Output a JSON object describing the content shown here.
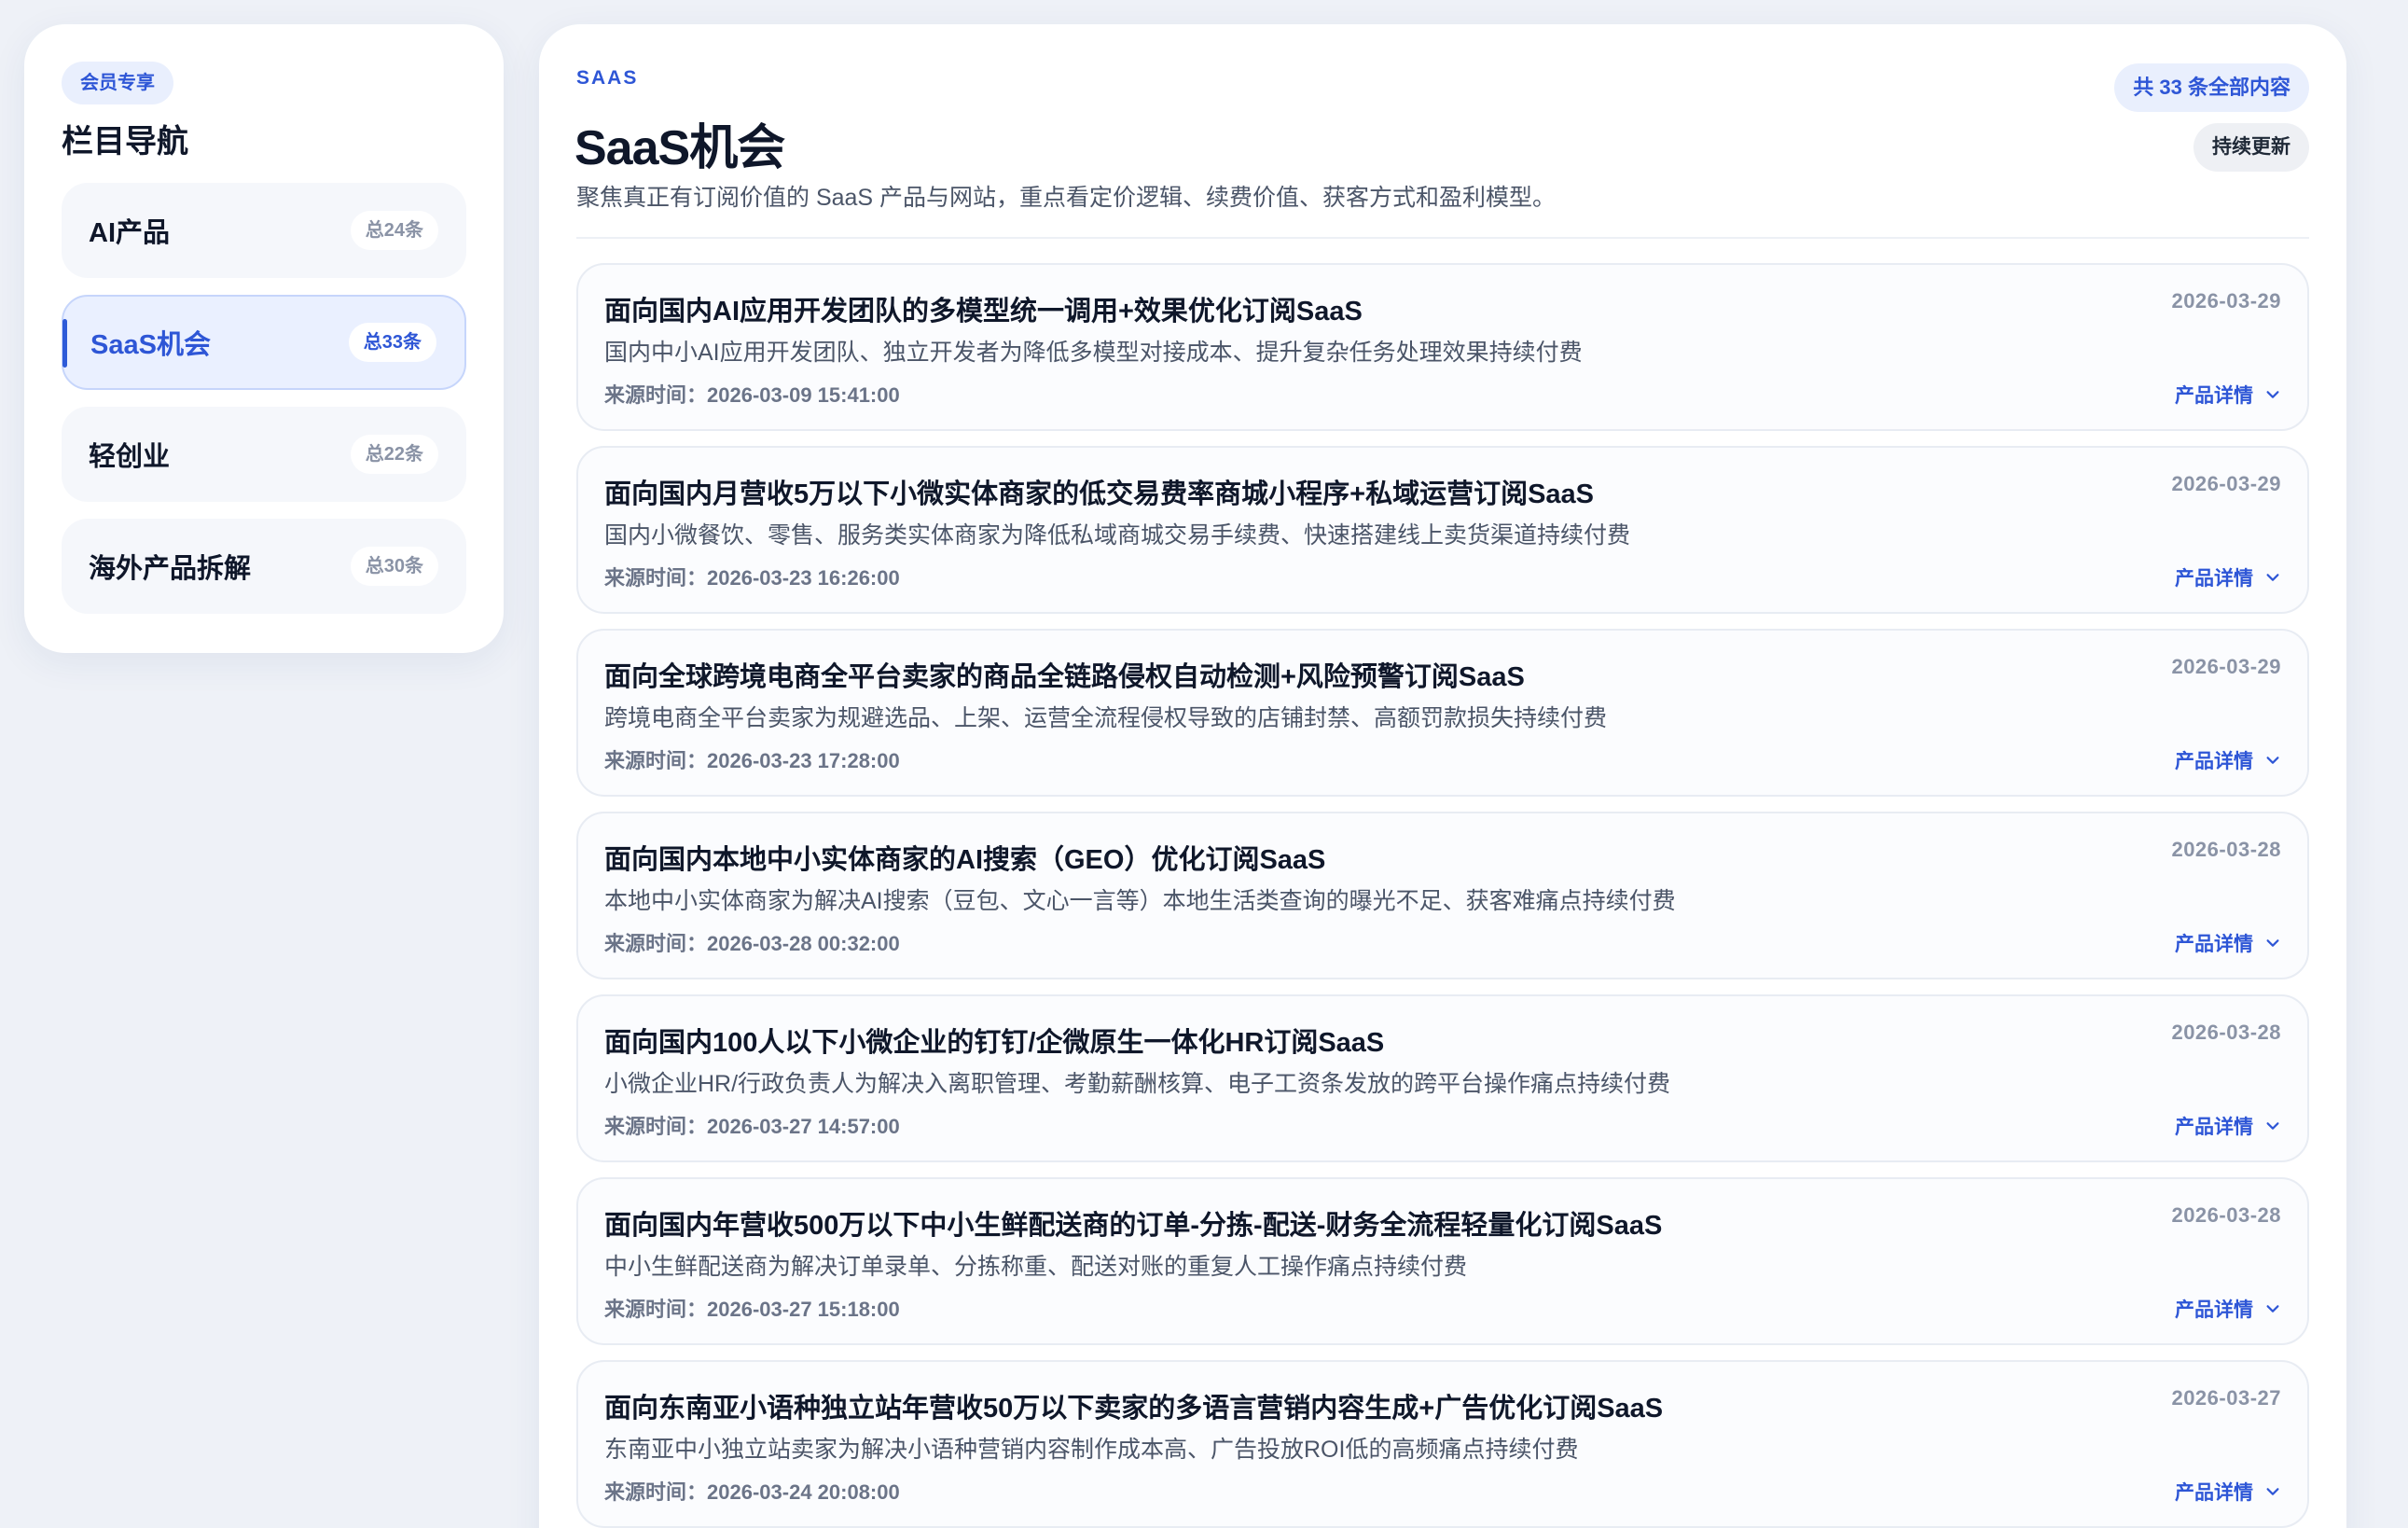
{
  "sidebar": {
    "badge": "会员专享",
    "title": "栏目导航",
    "items": [
      {
        "label": "AI产品",
        "count": "总24条",
        "active": false
      },
      {
        "label": "SaaS机会",
        "count": "总33条",
        "active": true
      },
      {
        "label": "轻创业",
        "count": "总22条",
        "active": false
      },
      {
        "label": "海外产品拆解",
        "count": "总30条",
        "active": false
      }
    ]
  },
  "main": {
    "kicker": "SAAS",
    "title": "SaaS机会",
    "description": "聚焦真正有订阅价值的 SaaS 产品与网站，重点看定价逻辑、续费价值、获客方式和盈利模型。",
    "total_badge": "共 33 条全部内容",
    "update_badge": "持续更新",
    "source_prefix": "来源时间：",
    "detail_label": "产品详情",
    "cards": [
      {
        "title": "面向国内AI应用开发团队的多模型统一调用+效果优化订阅SaaS",
        "date": "2026-03-29",
        "description": "国内中小AI应用开发团队、独立开发者为降低多模型对接成本、提升复杂任务处理效果持续付费",
        "source_time": "2026-03-09 15:41:00"
      },
      {
        "title": "面向国内月营收5万以下小微实体商家的低交易费率商城小程序+私域运营订阅SaaS",
        "date": "2026-03-29",
        "description": "国内小微餐饮、零售、服务类实体商家为降低私域商城交易手续费、快速搭建线上卖货渠道持续付费",
        "source_time": "2026-03-23 16:26:00"
      },
      {
        "title": "面向全球跨境电商全平台卖家的商品全链路侵权自动检测+风险预警订阅SaaS",
        "date": "2026-03-29",
        "description": "跨境电商全平台卖家为规避选品、上架、运营全流程侵权导致的店铺封禁、高额罚款损失持续付费",
        "source_time": "2026-03-23 17:28:00"
      },
      {
        "title": "面向国内本地中小实体商家的AI搜索（GEO）优化订阅SaaS",
        "date": "2026-03-28",
        "description": "本地中小实体商家为解决AI搜索（豆包、文心一言等）本地生活类查询的曝光不足、获客难痛点持续付费",
        "source_time": "2026-03-28 00:32:00"
      },
      {
        "title": "面向国内100人以下小微企业的钉钉/企微原生一体化HR订阅SaaS",
        "date": "2026-03-28",
        "description": "小微企业HR/行政负责人为解决入离职管理、考勤薪酬核算、电子工资条发放的跨平台操作痛点持续付费",
        "source_time": "2026-03-27 14:57:00"
      },
      {
        "title": "面向国内年营收500万以下中小生鲜配送商的订单-分拣-配送-财务全流程轻量化订阅SaaS",
        "date": "2026-03-28",
        "description": "中小生鲜配送商为解决订单录单、分拣称重、配送对账的重复人工操作痛点持续付费",
        "source_time": "2026-03-27 15:18:00"
      },
      {
        "title": "面向东南亚小语种独立站年营收50万以下卖家的多语言营销内容生成+广告优化订阅SaaS",
        "date": "2026-03-27",
        "description": "东南亚中小独立站卖家为解决小语种营销内容制作成本高、广告投放ROI低的高频痛点持续付费",
        "source_time": "2026-03-24 20:08:00"
      }
    ]
  },
  "colors": {
    "accent": "#2e56d6",
    "background": "#eef1f7",
    "card": "#ffffff"
  },
  "icons": {
    "detail_chevron": "chevron-down-icon"
  }
}
